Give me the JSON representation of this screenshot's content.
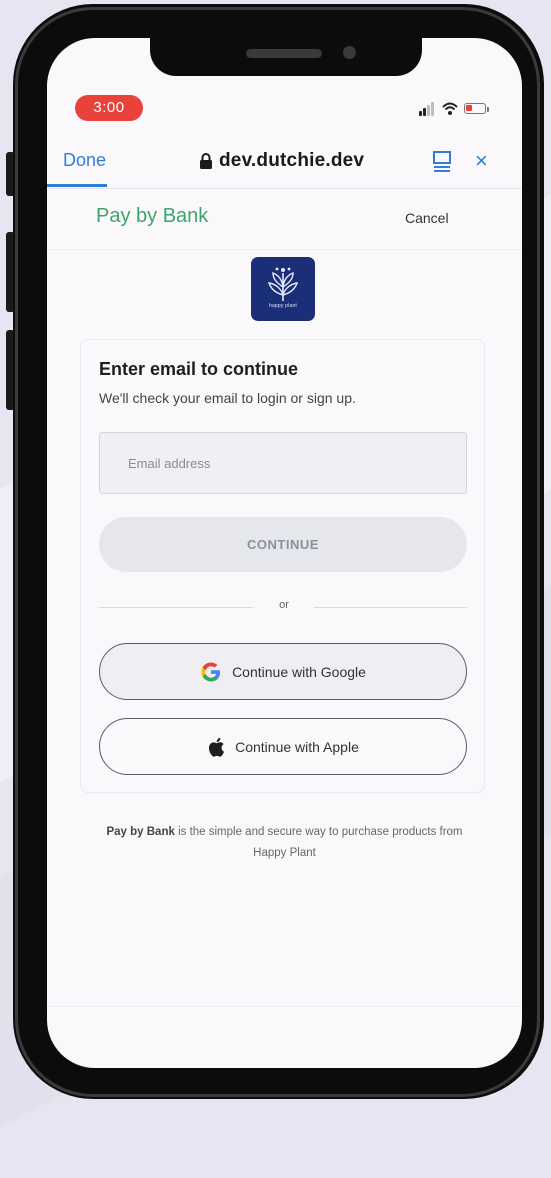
{
  "status_bar": {
    "time": "3:00"
  },
  "browser": {
    "done_label": "Done",
    "url": "dev.dutchie.dev",
    "close_label": "×"
  },
  "pay_by_bank": {
    "title": "Pay by Bank",
    "cancel_label": "Cancel"
  },
  "logo": {
    "lettering": "happy plant"
  },
  "card": {
    "title": "Enter email to continue",
    "subtitle": "We'll check your email to login or sign up.",
    "email_placeholder": "Email address",
    "email_value": "",
    "continue_label": "CONTINUE",
    "divider_label": "or",
    "google_label": "Continue with Google",
    "apple_label": "Continue with Apple"
  },
  "footer": {
    "brand": "Pay by Bank",
    "text": " is the simple and secure way to purchase products from Happy Plant"
  },
  "icons": {
    "lock": "lock-icon",
    "reader": "reader-icon",
    "close": "close-icon",
    "google": "google-icon",
    "apple": "apple-icon",
    "wifi": "wifi-icon",
    "battery": "battery-icon",
    "signal": "signal-icon"
  },
  "colors": {
    "time_pill": "#e8423a",
    "browser_accent": "#2f7fd6",
    "pay_by_bank_green": "#3aa66b",
    "logo_bg": "#1a2f78"
  }
}
